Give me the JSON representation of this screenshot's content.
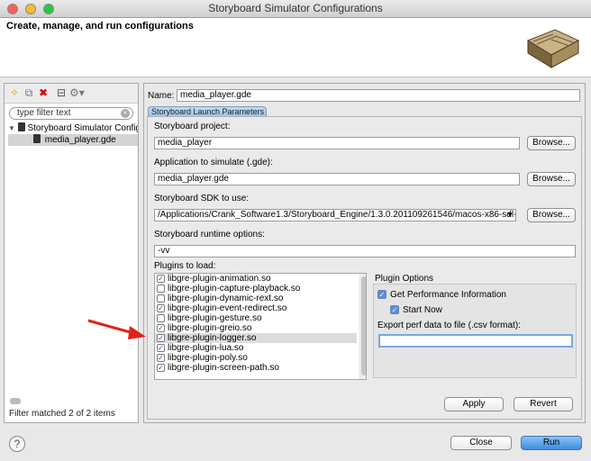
{
  "window": {
    "title": "Storyboard Simulator Configurations"
  },
  "header": {
    "subtitle": "Create, manage, and run configurations"
  },
  "left": {
    "filter_placeholder": "type filter text",
    "tree": [
      {
        "label": "Storyboard Simulator Configu",
        "expanded": true
      },
      {
        "label": "media_player.gde",
        "selected": true
      }
    ],
    "status": "Filter matched 2 of 2 items"
  },
  "config": {
    "name_label": "Name:",
    "name_value": "media_player.gde",
    "tab_label": "Storyboard Launch Parameters",
    "project_label": "Storyboard project:",
    "project_value": "media_player",
    "app_label": "Application to simulate (.gde):",
    "app_value": "media_player.gde",
    "sdk_label": "Storyboard SDK to use:",
    "sdk_value": "/Applications/Crank_Software1.3/Storyboard_Engine/1.3.0.201109261546/macos-x86-sdl-obj",
    "runtime_label": "Storyboard runtime options:",
    "runtime_value": "-vv",
    "browse_label": "Browse...",
    "plugins_label": "Plugins to load:",
    "plugins": [
      {
        "name": "libgre-plugin-animation.so",
        "checked": true
      },
      {
        "name": "libgre-plugin-capture-playback.so",
        "checked": false
      },
      {
        "name": "libgre-plugin-dynamic-rext.so",
        "checked": false
      },
      {
        "name": "libgre-plugin-event-redirect.so",
        "checked": true
      },
      {
        "name": "libgre-plugin-gesture.so",
        "checked": false
      },
      {
        "name": "libgre-plugin-greio.so",
        "checked": true
      },
      {
        "name": "libgre-plugin-logger.so",
        "checked": true,
        "selected": true
      },
      {
        "name": "libgre-plugin-lua.so",
        "checked": true
      },
      {
        "name": "libgre-plugin-poly.so",
        "checked": true
      },
      {
        "name": "libgre-plugin-screen-path.so",
        "checked": true
      }
    ],
    "options_title": "Plugin Options",
    "opt_get_perf": "Get Performance Information",
    "opt_start_now": "Start Now",
    "export_label": "Export perf data to file (.csv format):",
    "export_value": ""
  },
  "buttons": {
    "apply": "Apply",
    "revert": "Revert",
    "close": "Close",
    "run": "Run"
  },
  "icons": {
    "help": "?"
  },
  "colors": {
    "accent": "#3b8de2",
    "arrow": "#e0231a"
  }
}
